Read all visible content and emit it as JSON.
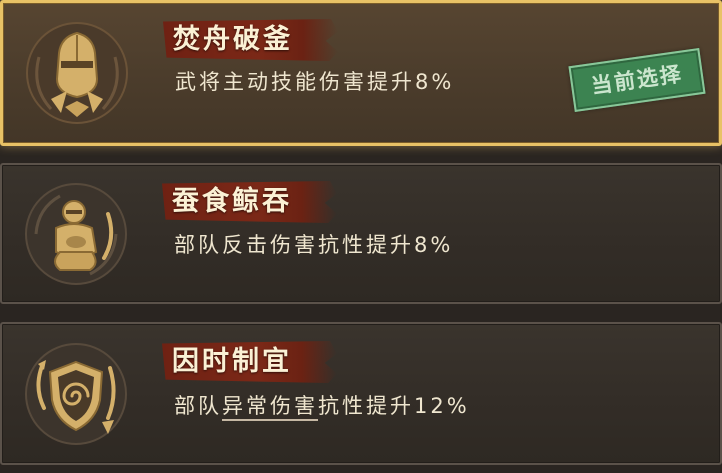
{
  "cards": [
    {
      "title": "焚舟破釜",
      "desc": "武将主动技能伤害提升8%",
      "icon": "armored-helmet-icon",
      "selected": true,
      "badge": "当前选择"
    },
    {
      "title": "蚕食鲸吞",
      "desc": "部队反击伤害抗性提升8%",
      "icon": "kneeling-warrior-icon",
      "selected": false
    },
    {
      "title": "因时制宜",
      "desc_prefix": "部队",
      "desc_highlight": "异常伤害",
      "desc_suffix": "抗性提升12%",
      "icon": "spiral-shield-icon",
      "selected": false
    }
  ],
  "colors": {
    "selected_border": "#e8c266",
    "ribbon": "#7b2817",
    "badge": "#3b8a55",
    "icon_gold": "#d4b06a"
  }
}
